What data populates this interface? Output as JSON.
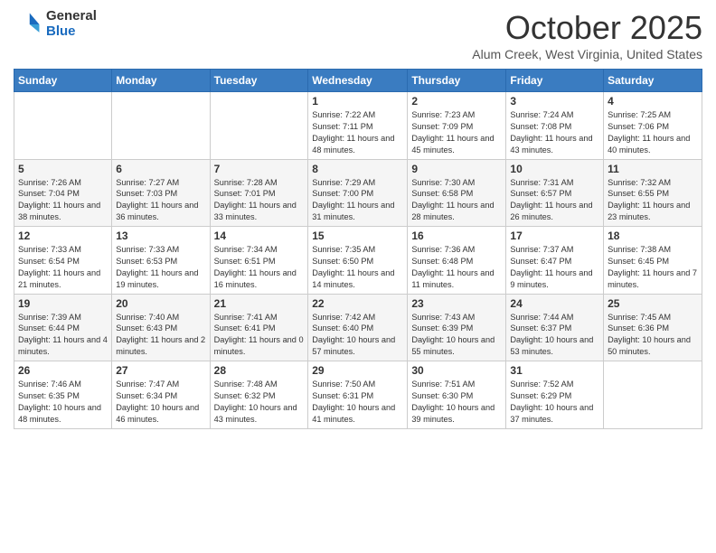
{
  "logo": {
    "general": "General",
    "blue": "Blue"
  },
  "title": "October 2025",
  "location": "Alum Creek, West Virginia, United States",
  "days_of_week": [
    "Sunday",
    "Monday",
    "Tuesday",
    "Wednesday",
    "Thursday",
    "Friday",
    "Saturday"
  ],
  "weeks": [
    [
      {
        "day": "",
        "info": ""
      },
      {
        "day": "",
        "info": ""
      },
      {
        "day": "",
        "info": ""
      },
      {
        "day": "1",
        "info": "Sunrise: 7:22 AM\nSunset: 7:11 PM\nDaylight: 11 hours and 48 minutes."
      },
      {
        "day": "2",
        "info": "Sunrise: 7:23 AM\nSunset: 7:09 PM\nDaylight: 11 hours and 45 minutes."
      },
      {
        "day": "3",
        "info": "Sunrise: 7:24 AM\nSunset: 7:08 PM\nDaylight: 11 hours and 43 minutes."
      },
      {
        "day": "4",
        "info": "Sunrise: 7:25 AM\nSunset: 7:06 PM\nDaylight: 11 hours and 40 minutes."
      }
    ],
    [
      {
        "day": "5",
        "info": "Sunrise: 7:26 AM\nSunset: 7:04 PM\nDaylight: 11 hours and 38 minutes."
      },
      {
        "day": "6",
        "info": "Sunrise: 7:27 AM\nSunset: 7:03 PM\nDaylight: 11 hours and 36 minutes."
      },
      {
        "day": "7",
        "info": "Sunrise: 7:28 AM\nSunset: 7:01 PM\nDaylight: 11 hours and 33 minutes."
      },
      {
        "day": "8",
        "info": "Sunrise: 7:29 AM\nSunset: 7:00 PM\nDaylight: 11 hours and 31 minutes."
      },
      {
        "day": "9",
        "info": "Sunrise: 7:30 AM\nSunset: 6:58 PM\nDaylight: 11 hours and 28 minutes."
      },
      {
        "day": "10",
        "info": "Sunrise: 7:31 AM\nSunset: 6:57 PM\nDaylight: 11 hours and 26 minutes."
      },
      {
        "day": "11",
        "info": "Sunrise: 7:32 AM\nSunset: 6:55 PM\nDaylight: 11 hours and 23 minutes."
      }
    ],
    [
      {
        "day": "12",
        "info": "Sunrise: 7:33 AM\nSunset: 6:54 PM\nDaylight: 11 hours and 21 minutes."
      },
      {
        "day": "13",
        "info": "Sunrise: 7:33 AM\nSunset: 6:53 PM\nDaylight: 11 hours and 19 minutes."
      },
      {
        "day": "14",
        "info": "Sunrise: 7:34 AM\nSunset: 6:51 PM\nDaylight: 11 hours and 16 minutes."
      },
      {
        "day": "15",
        "info": "Sunrise: 7:35 AM\nSunset: 6:50 PM\nDaylight: 11 hours and 14 minutes."
      },
      {
        "day": "16",
        "info": "Sunrise: 7:36 AM\nSunset: 6:48 PM\nDaylight: 11 hours and 11 minutes."
      },
      {
        "day": "17",
        "info": "Sunrise: 7:37 AM\nSunset: 6:47 PM\nDaylight: 11 hours and 9 minutes."
      },
      {
        "day": "18",
        "info": "Sunrise: 7:38 AM\nSunset: 6:45 PM\nDaylight: 11 hours and 7 minutes."
      }
    ],
    [
      {
        "day": "19",
        "info": "Sunrise: 7:39 AM\nSunset: 6:44 PM\nDaylight: 11 hours and 4 minutes."
      },
      {
        "day": "20",
        "info": "Sunrise: 7:40 AM\nSunset: 6:43 PM\nDaylight: 11 hours and 2 minutes."
      },
      {
        "day": "21",
        "info": "Sunrise: 7:41 AM\nSunset: 6:41 PM\nDaylight: 11 hours and 0 minutes."
      },
      {
        "day": "22",
        "info": "Sunrise: 7:42 AM\nSunset: 6:40 PM\nDaylight: 10 hours and 57 minutes."
      },
      {
        "day": "23",
        "info": "Sunrise: 7:43 AM\nSunset: 6:39 PM\nDaylight: 10 hours and 55 minutes."
      },
      {
        "day": "24",
        "info": "Sunrise: 7:44 AM\nSunset: 6:37 PM\nDaylight: 10 hours and 53 minutes."
      },
      {
        "day": "25",
        "info": "Sunrise: 7:45 AM\nSunset: 6:36 PM\nDaylight: 10 hours and 50 minutes."
      }
    ],
    [
      {
        "day": "26",
        "info": "Sunrise: 7:46 AM\nSunset: 6:35 PM\nDaylight: 10 hours and 48 minutes."
      },
      {
        "day": "27",
        "info": "Sunrise: 7:47 AM\nSunset: 6:34 PM\nDaylight: 10 hours and 46 minutes."
      },
      {
        "day": "28",
        "info": "Sunrise: 7:48 AM\nSunset: 6:32 PM\nDaylight: 10 hours and 43 minutes."
      },
      {
        "day": "29",
        "info": "Sunrise: 7:50 AM\nSunset: 6:31 PM\nDaylight: 10 hours and 41 minutes."
      },
      {
        "day": "30",
        "info": "Sunrise: 7:51 AM\nSunset: 6:30 PM\nDaylight: 10 hours and 39 minutes."
      },
      {
        "day": "31",
        "info": "Sunrise: 7:52 AM\nSunset: 6:29 PM\nDaylight: 10 hours and 37 minutes."
      },
      {
        "day": "",
        "info": ""
      }
    ]
  ]
}
